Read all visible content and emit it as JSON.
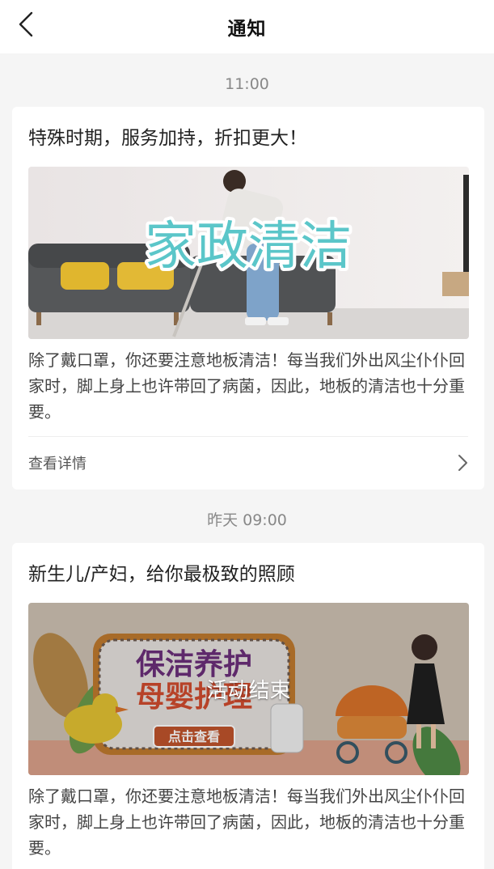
{
  "header": {
    "title": "通知",
    "back_icon": "chevron-left-icon"
  },
  "notifications": [
    {
      "time": "11:00",
      "title": "特殊时期，服务加持，折扣更大！",
      "banner_text": "家政清洁",
      "body": "除了戴口罩，你还要注意地板清洁！每当我们外出风尘仆仆回家时，脚上身上也许带回了病菌，因此，地板的清洁也十分重要。",
      "detail_label": "查看详情",
      "detail_icon": "chevron-right-icon"
    },
    {
      "time": "昨天 09:00",
      "title": "新生儿/产妇，给你最极致的照顾",
      "banner_line1": "保洁养护",
      "banner_line2": "母婴护理",
      "banner_button": "点击查看",
      "overlay_text": "活动结束",
      "body": "除了戴口罩，你还要注意地板清洁！每当我们外出风尘仆仆回家时，脚上身上也许带回了病菌，因此，地板的清洁也十分重要。"
    }
  ],
  "colors": {
    "background": "#f5f5f5",
    "card": "#ffffff",
    "banner1_text": "#5bc6c9",
    "banner2_title": "#6b2f7a",
    "banner2_sub": "#d14c2e"
  }
}
